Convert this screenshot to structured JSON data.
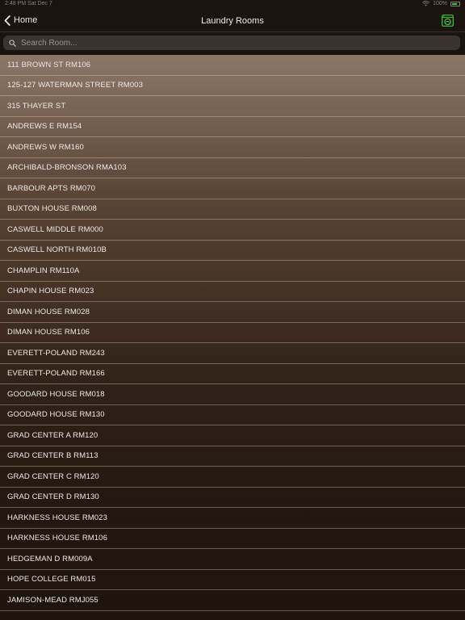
{
  "status_bar": {
    "time_date": "2:48 PM   Sat Dec 7",
    "battery_text": "100%"
  },
  "nav": {
    "back_label": "Home",
    "title": "Laundry Rooms",
    "washer_icon_color": "#3fc940"
  },
  "search": {
    "placeholder": "Search Room..."
  },
  "rooms": [
    "111 BROWN ST RM106",
    "125-127 WATERMAN STREET RM003",
    "315 THAYER ST",
    "ANDREWS E RM154",
    "ANDREWS W RM160",
    "ARCHIBALD-BRONSON RMA103",
    "BARBOUR APTS RM070",
    "BUXTON HOUSE RM008",
    "CASWELL MIDDLE RM000",
    "CASWELL NORTH RM010B",
    "CHAMPLIN RM110A",
    "CHAPIN HOUSE RM023",
    "DIMAN HOUSE RM028",
    "DIMAN HOUSE RM106",
    "EVERETT-POLAND RM243",
    "EVERETT-POLAND RM166",
    "GOODARD HOUSE RM018",
    "GOODARD HOUSE RM130",
    "GRAD CENTER A RM120",
    "GRAD CENTER B RM113",
    "GRAD CENTER C RM120",
    "GRAD CENTER D RM130",
    "HARKNESS HOUSE RM023",
    "HARKNESS HOUSE RM106",
    "HEDGEMAN D RM009A",
    "HOPE COLLEGE RM015",
    "JAMISON-MEAD RMJ055"
  ]
}
